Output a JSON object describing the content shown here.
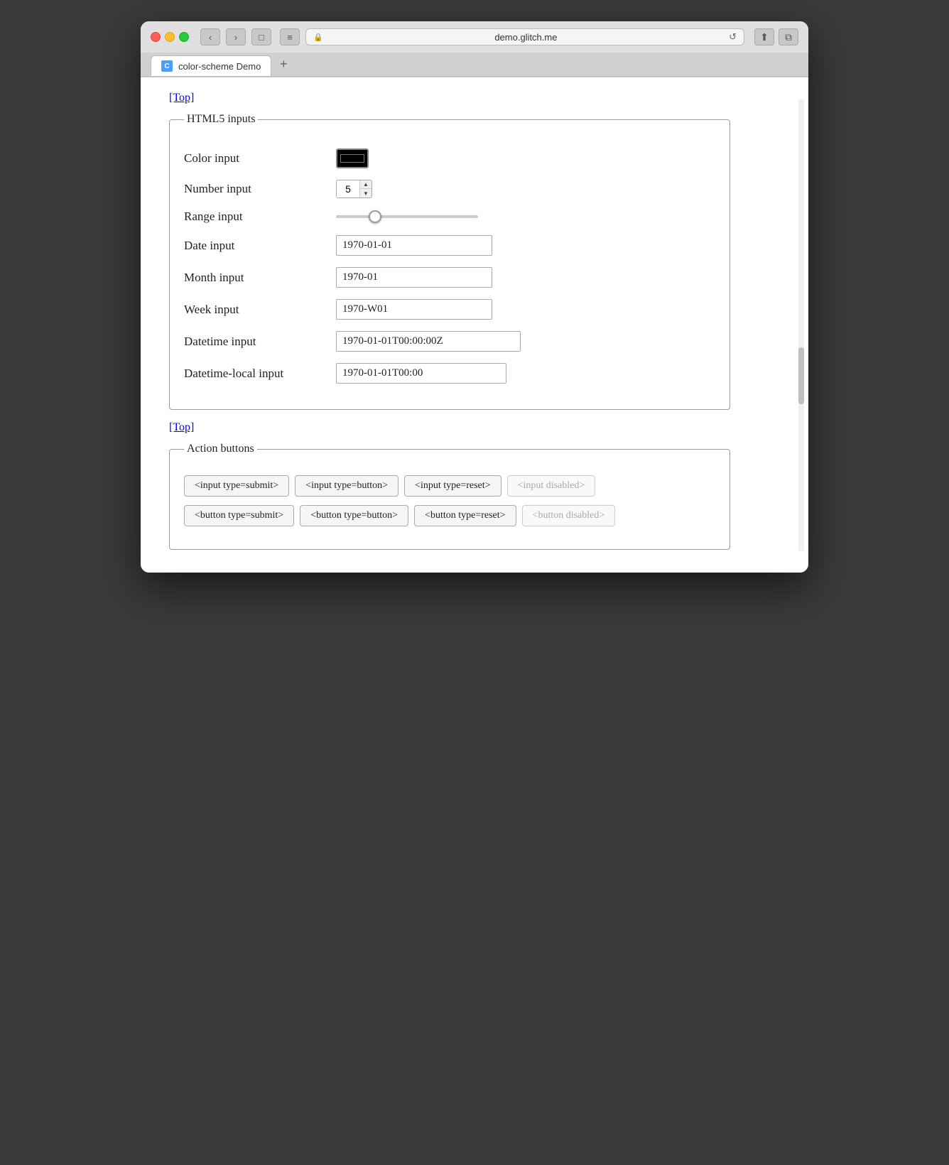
{
  "browser": {
    "url": "demo.glitch.me",
    "tab_title": "color-scheme Demo",
    "tab_favicon": "C",
    "reload_icon": "↺",
    "share_icon": "⬆",
    "new_tab_icon": "+",
    "back_icon": "‹",
    "forward_icon": "›",
    "sidebar_icon": "□",
    "menu_icon": "≡"
  },
  "page": {
    "top_link": "[Top]",
    "html5_section": {
      "legend": "HTML5 inputs",
      "fields": [
        {
          "label": "Color input",
          "type": "color",
          "value": "#000000"
        },
        {
          "label": "Number input",
          "type": "number",
          "value": "5"
        },
        {
          "label": "Range input",
          "type": "range",
          "value": "25"
        },
        {
          "label": "Date input",
          "type": "date",
          "value": "1970-01-01"
        },
        {
          "label": "Month input",
          "type": "month",
          "value": "1970-01"
        },
        {
          "label": "Week input",
          "type": "week",
          "value": "1970-W01"
        },
        {
          "label": "Datetime input",
          "type": "datetime",
          "value": "1970-01-01T00:00:00Z"
        },
        {
          "label": "Datetime-local input",
          "type": "datetime-local",
          "value": "1970-01-01T00:00"
        }
      ]
    },
    "action_section": {
      "legend": "Action buttons",
      "input_buttons": [
        {
          "label": "<input type=submit>",
          "disabled": false
        },
        {
          "label": "<input type=button>",
          "disabled": false
        },
        {
          "label": "<input type=reset>",
          "disabled": false
        },
        {
          "label": "<input disabled>",
          "disabled": true
        }
      ],
      "button_buttons": [
        {
          "label": "<button type=submit>",
          "disabled": false
        },
        {
          "label": "<button type=button>",
          "disabled": false
        },
        {
          "label": "<button type=reset>",
          "disabled": false
        },
        {
          "label": "<button disabled>",
          "disabled": true
        }
      ]
    }
  }
}
